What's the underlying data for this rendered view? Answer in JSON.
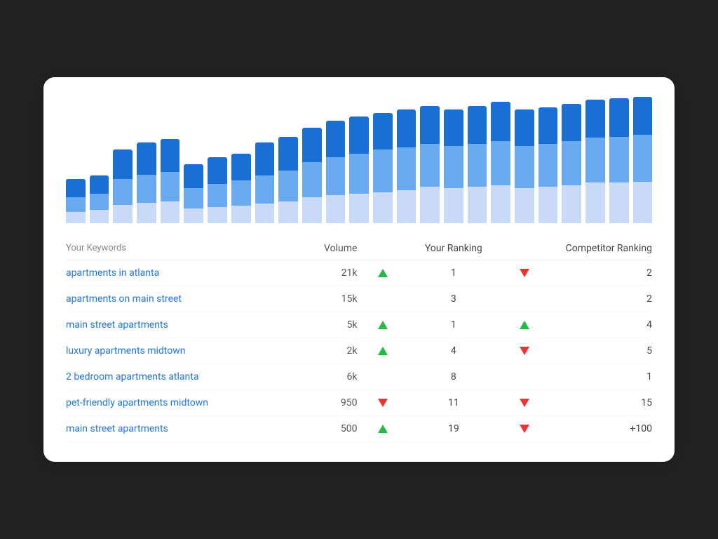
{
  "chart": {
    "bars": [
      {
        "total": 60,
        "segments": [
          15,
          20,
          25
        ]
      },
      {
        "total": 65,
        "segments": [
          18,
          22,
          25
        ]
      },
      {
        "total": 100,
        "segments": [
          25,
          35,
          40
        ]
      },
      {
        "total": 110,
        "segments": [
          28,
          38,
          44
        ]
      },
      {
        "total": 115,
        "segments": [
          30,
          40,
          45
        ]
      },
      {
        "total": 80,
        "segments": [
          20,
          28,
          32
        ]
      },
      {
        "total": 90,
        "segments": [
          22,
          32,
          36
        ]
      },
      {
        "total": 95,
        "segments": [
          24,
          34,
          37
        ]
      },
      {
        "total": 110,
        "segments": [
          27,
          38,
          45
        ]
      },
      {
        "total": 118,
        "segments": [
          30,
          42,
          46
        ]
      },
      {
        "total": 130,
        "segments": [
          35,
          48,
          47
        ]
      },
      {
        "total": 140,
        "segments": [
          38,
          52,
          50
        ]
      },
      {
        "total": 145,
        "segments": [
          40,
          55,
          50
        ]
      },
      {
        "total": 150,
        "segments": [
          42,
          58,
          50
        ]
      },
      {
        "total": 155,
        "segments": [
          45,
          58,
          52
        ]
      },
      {
        "total": 160,
        "segments": [
          50,
          58,
          52
        ]
      },
      {
        "total": 155,
        "segments": [
          48,
          57,
          50
        ]
      },
      {
        "total": 160,
        "segments": [
          50,
          58,
          52
        ]
      },
      {
        "total": 165,
        "segments": [
          52,
          60,
          53
        ]
      },
      {
        "total": 155,
        "segments": [
          48,
          57,
          50
        ]
      },
      {
        "total": 158,
        "segments": [
          50,
          58,
          50
        ]
      },
      {
        "total": 162,
        "segments": [
          52,
          60,
          50
        ]
      },
      {
        "total": 168,
        "segments": [
          55,
          62,
          51
        ]
      },
      {
        "total": 170,
        "segments": [
          55,
          63,
          52
        ]
      },
      {
        "total": 172,
        "segments": [
          56,
          64,
          52
        ]
      }
    ],
    "colors": [
      "#c8daf7",
      "#6aaaf0",
      "#1a6fd4"
    ]
  },
  "table": {
    "headers": {
      "keywords": "Your Keywords",
      "volume": "Volume",
      "your_ranking": "Your Ranking",
      "competitor_ranking": "Competitor Ranking"
    },
    "rows": [
      {
        "keyword": "apartments in atlanta",
        "volume": "21k",
        "your_arrow": "up",
        "your_rank": "1",
        "comp_arrow": "down",
        "comp_rank": "2"
      },
      {
        "keyword": "apartments on main street",
        "volume": "15k",
        "your_arrow": "none",
        "your_rank": "3",
        "comp_arrow": "none",
        "comp_rank": "2"
      },
      {
        "keyword": "main street apartments",
        "volume": "5k",
        "your_arrow": "up",
        "your_rank": "1",
        "comp_arrow": "up",
        "comp_rank": "4"
      },
      {
        "keyword": "luxury apartments midtown",
        "volume": "2k",
        "your_arrow": "up",
        "your_rank": "4",
        "comp_arrow": "down",
        "comp_rank": "5"
      },
      {
        "keyword": "2 bedroom apartments atlanta",
        "volume": "6k",
        "your_arrow": "none",
        "your_rank": "8",
        "comp_arrow": "none",
        "comp_rank": "1"
      },
      {
        "keyword": "pet-friendly apartments midtown",
        "volume": "950",
        "your_arrow": "down",
        "your_rank": "11",
        "comp_arrow": "down",
        "comp_rank": "15"
      },
      {
        "keyword": "main street apartments",
        "volume": "500",
        "your_arrow": "up",
        "your_rank": "19",
        "comp_arrow": "down",
        "comp_rank": "+100"
      }
    ]
  }
}
